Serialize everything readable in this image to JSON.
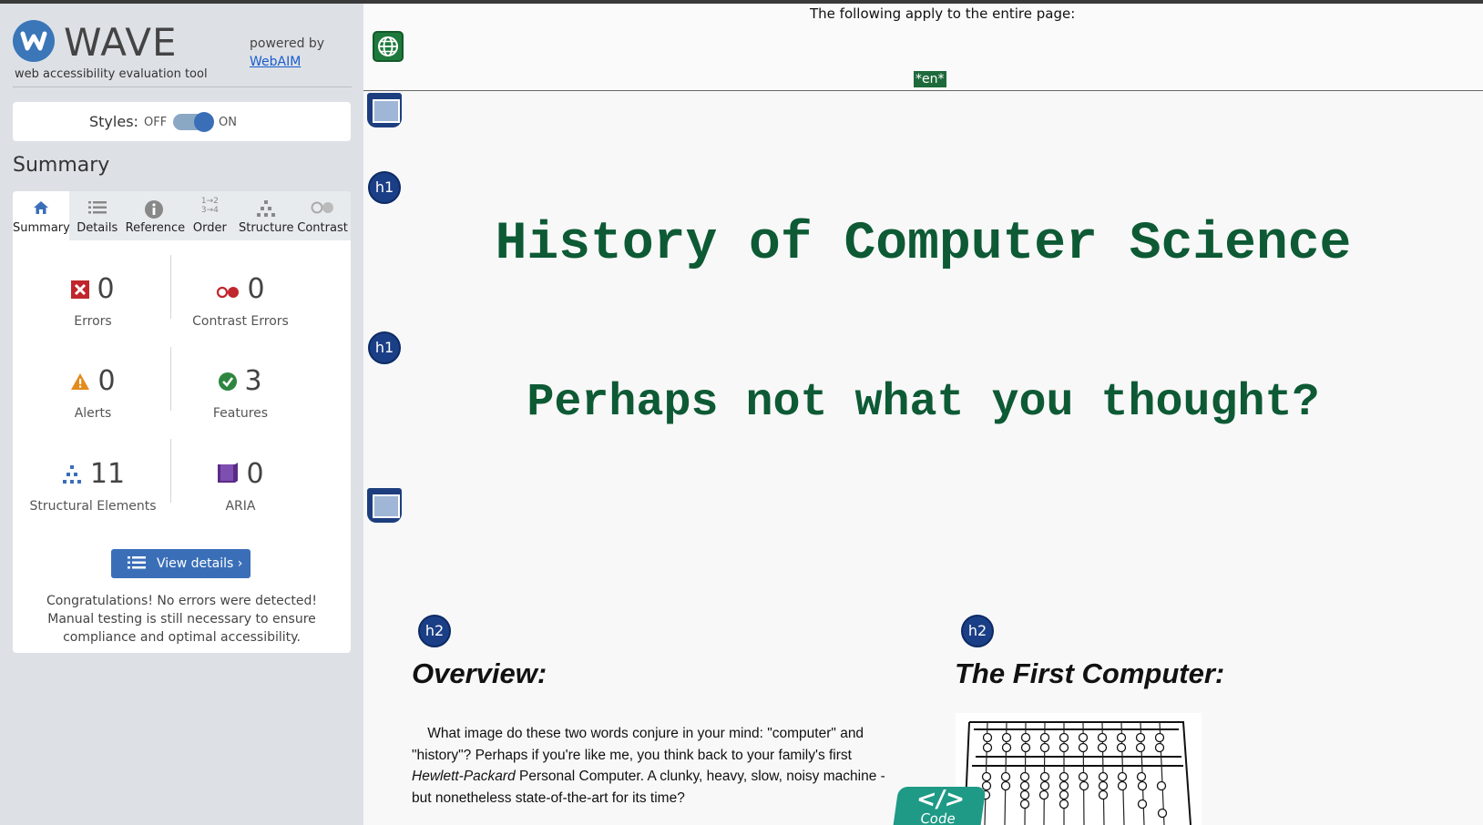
{
  "brand": {
    "name": "WAVE",
    "subtitle": "web accessibility evaluation tool",
    "powered_by": "powered by",
    "webaim_link": "WebAIM"
  },
  "styles_toggle": {
    "label": "Styles:",
    "off": "OFF",
    "on": "ON",
    "state": "on"
  },
  "summary": {
    "title": "Summary",
    "tabs": [
      {
        "label": "Summary",
        "icon": "home-icon",
        "active": true
      },
      {
        "label": "Details",
        "icon": "list-icon",
        "active": false
      },
      {
        "label": "Reference",
        "icon": "info-icon",
        "active": false
      },
      {
        "label": "Order",
        "icon": "order-icon",
        "active": false
      },
      {
        "label": "Structure",
        "icon": "structure-icon",
        "active": false
      },
      {
        "label": "Contrast",
        "icon": "contrast-icon",
        "active": false
      }
    ],
    "stats": {
      "errors": {
        "count": "0",
        "label": "Errors",
        "color": "#c0262d"
      },
      "contrast_errors": {
        "count": "0",
        "label": "Contrast Errors",
        "color": "#c0262d"
      },
      "alerts": {
        "count": "0",
        "label": "Alerts",
        "color": "#e38b1c"
      },
      "features": {
        "count": "3",
        "label": "Features",
        "color": "#2e8540"
      },
      "structural": {
        "count": "11",
        "label": "Structural Elements",
        "color": "#3a6fb8"
      },
      "aria": {
        "count": "0",
        "label": "ARIA",
        "color": "#5b2a86"
      }
    },
    "view_details": "View details ›",
    "congrats": "Congratulations! No errors were detected! Manual testing is still necessary to ensure compliance and optimal accessibility."
  },
  "page": {
    "note": "The following apply to the entire page:",
    "lang": "*en*",
    "h1_main": "History of Computer Science",
    "h1_sub": "Perhaps not what you thought?",
    "h2_overview": "Overview:",
    "h2_first": "The First Computer:",
    "h1_icon": "h1",
    "h2_icon": "h2",
    "para_part1": "What image do these two words conjure in your mind: \"computer\" and \"history\"? Perhaps if you're like me, you think back to your family's first ",
    "para_em": "Hewlett-Packard",
    "para_part2": " Personal Computer. A clunky, heavy, slow, noisy machine - but nonetheless state-of-the-art for its time?",
    "code_badge": {
      "symbol": "</>",
      "label": "Code"
    }
  }
}
